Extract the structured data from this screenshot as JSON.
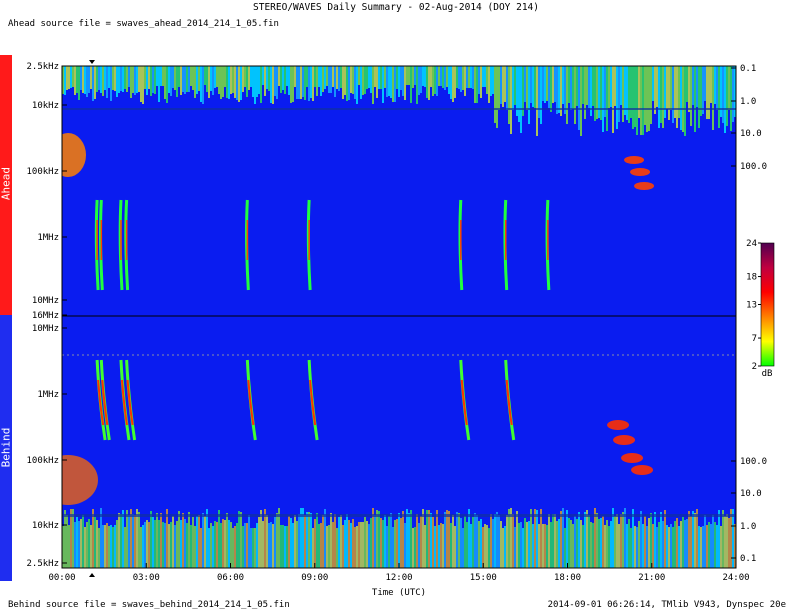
{
  "header": {
    "title": "STEREO/WAVES Daily Summary - 02-Aug-2014 (DOY 214)",
    "ahead_source": "Ahead source file = swaves_ahead_2014_214_1_05.fin",
    "behind_source": "Behind source file = swaves_behind_2014_214_1_05.fin",
    "footer_stamp": "2014-09-01 06:26:14, TMlib V943, Dynspec 20e"
  },
  "panels": {
    "ahead_label": "Ahead",
    "behind_label": "Behind",
    "ahead_color": "#ff1a1a",
    "behind_color": "#1f2df0"
  },
  "chart_data": {
    "type": "heatmap",
    "title": "STEREO/WAVES Daily Summary - 02-Aug-2014 (DOY 214)",
    "xlabel": "Time (UTC)",
    "x_ticks": [
      "00:00",
      "03:00",
      "06:00",
      "09:00",
      "12:00",
      "15:00",
      "18:00",
      "21:00",
      "24:00"
    ],
    "xlim": [
      "00:00",
      "24:00"
    ],
    "ahead_panel": {
      "freq_ticks": [
        "2.5kHz",
        "10kHz",
        "100kHz",
        "1MHz",
        "10MHz",
        "16MHz"
      ],
      "right_ticks": [
        "0.1",
        "1.0",
        "10.0",
        "100.0"
      ]
    },
    "behind_panel": {
      "freq_ticks": [
        "16MHz",
        "10MHz",
        "1MHz",
        "100kHz",
        "10kHz",
        "2.5kHz"
      ],
      "right_ticks": [
        "100.0",
        "10.0",
        "1.0",
        "0.1"
      ]
    },
    "colorbar": {
      "unit": "dB",
      "ticks": [
        "24",
        "18",
        "13",
        "7",
        "2"
      ],
      "range": [
        2,
        24
      ],
      "colors": [
        "#00ff00",
        "#ffff00",
        "#ff8000",
        "#ff0000",
        "#c00040",
        "#500050"
      ]
    },
    "background_color": "#0a1cf0",
    "features": [
      {
        "time_h": 0.2,
        "panel": "ahead",
        "kind": "low-frequency burst"
      },
      {
        "time_h": 1.25,
        "panel": "both",
        "kind": "type III burst"
      },
      {
        "time_h": 1.4,
        "panel": "both",
        "kind": "type III burst"
      },
      {
        "time_h": 2.1,
        "panel": "both",
        "kind": "type III burst"
      },
      {
        "time_h": 2.3,
        "panel": "both",
        "kind": "type III burst"
      },
      {
        "time_h": 6.6,
        "panel": "both",
        "kind": "type III burst"
      },
      {
        "time_h": 8.8,
        "panel": "both",
        "kind": "type III burst"
      },
      {
        "time_h": 14.2,
        "panel": "both",
        "kind": "type III burst"
      },
      {
        "time_h": 15.8,
        "panel": "both",
        "kind": "type III burst"
      },
      {
        "time_h": 17.3,
        "panel": "ahead",
        "kind": "type III burst"
      },
      {
        "time_h": 19.8,
        "panel": "both",
        "kind": "type II emission"
      }
    ]
  }
}
